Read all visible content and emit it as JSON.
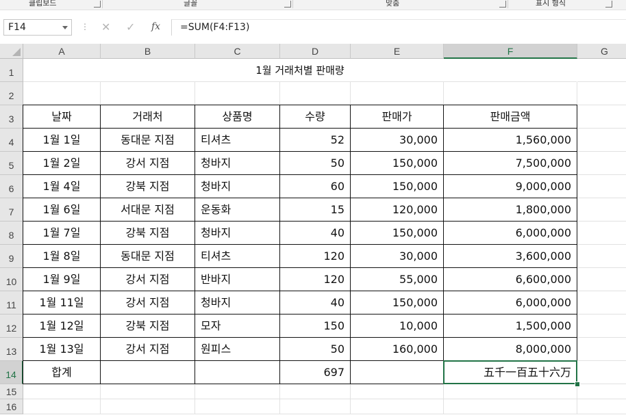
{
  "ribbon": {
    "groups": [
      "클립보드",
      "글꼴",
      "맞춤",
      "표시 형식"
    ]
  },
  "formula_bar": {
    "name_box": "F14",
    "formula": "=SUM(F4:F13)",
    "fx_label": "fx",
    "cancel_icon": "✕",
    "enter_icon": "✓",
    "dots": "⋮"
  },
  "columns": [
    "A",
    "B",
    "C",
    "D",
    "E",
    "F",
    "G"
  ],
  "rows": [
    "1",
    "2",
    "3",
    "4",
    "5",
    "6",
    "7",
    "8",
    "9",
    "10",
    "11",
    "12",
    "13",
    "14",
    "15",
    "16"
  ],
  "sheet": {
    "title": "1월 거래처별 판매량",
    "headers": [
      "날짜",
      "거래처",
      "상품명",
      "수량",
      "판매가",
      "판매금액"
    ],
    "data": [
      [
        "1월 1일",
        "동대문 지점",
        "티셔츠",
        "52",
        "30,000",
        "1,560,000"
      ],
      [
        "1월 2일",
        "강서 지점",
        "청바지",
        "50",
        "150,000",
        "7,500,000"
      ],
      [
        "1월 4일",
        "강북 지점",
        "청바지",
        "60",
        "150,000",
        "9,000,000"
      ],
      [
        "1월 6일",
        "서대문 지점",
        "운동화",
        "15",
        "120,000",
        "1,800,000"
      ],
      [
        "1월 7일",
        "강북 지점",
        "청바지",
        "40",
        "150,000",
        "6,000,000"
      ],
      [
        "1월 8일",
        "동대문 지점",
        "티셔츠",
        "120",
        "30,000",
        "3,600,000"
      ],
      [
        "1월 9일",
        "강서 지점",
        "반바지",
        "120",
        "55,000",
        "6,600,000"
      ],
      [
        "1월 11일",
        "강서  지점",
        "청바지",
        "40",
        "150,000",
        "6,000,000"
      ],
      [
        "1월 12일",
        "강북 지점",
        "모자",
        "150",
        "10,000",
        "1,500,000"
      ],
      [
        "1월 13일",
        "강서 지점",
        "원피스",
        "50",
        "160,000",
        "8,000,000"
      ]
    ],
    "total": [
      "합계",
      "",
      "",
      "697",
      "",
      "五千一百五十六万"
    ]
  },
  "selected_cell": "F14",
  "colors": {
    "accent": "#217346"
  }
}
